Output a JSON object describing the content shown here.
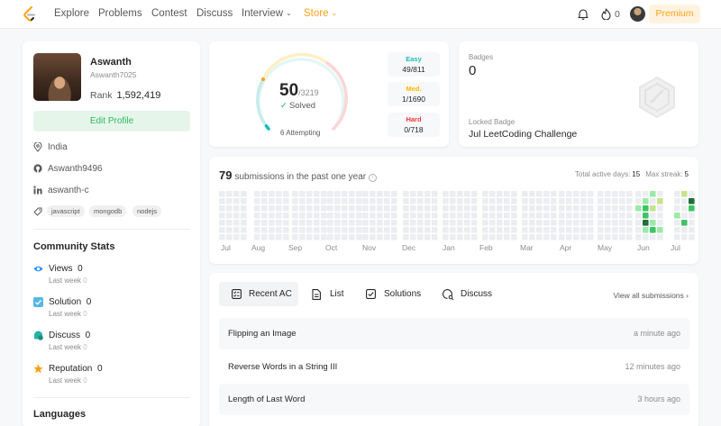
{
  "nav": {
    "items": [
      "Explore",
      "Problems",
      "Contest",
      "Discuss",
      "Interview",
      "Store"
    ],
    "fire_count": "0",
    "premium_label": "Premium"
  },
  "profile": {
    "name": "Aswanth",
    "username": "Aswanth7025",
    "rank_label": "Rank",
    "rank_value": "1,592,419",
    "edit_label": "Edit Profile",
    "location": "India",
    "github": "Aswanth9496",
    "linkedin": "aswanth-c",
    "skills": [
      "javascript",
      "mongodb",
      "nodejs"
    ]
  },
  "community": {
    "title": "Community Stats",
    "items": [
      {
        "label": "Views",
        "value": "0",
        "sub_label": "Last week",
        "sub_value": "0",
        "color": "#1890ff"
      },
      {
        "label": "Solution",
        "value": "0",
        "sub_label": "Last week",
        "sub_value": "0",
        "color": "#57b8e6"
      },
      {
        "label": "Discuss",
        "value": "0",
        "sub_label": "Last week",
        "sub_value": "0",
        "color": "#26b2a6"
      },
      {
        "label": "Reputation",
        "value": "0",
        "sub_label": "Last week",
        "sub_value": "0",
        "color": "#ffa116"
      }
    ]
  },
  "languages_title": "Languages",
  "solved": {
    "count": "50",
    "total": "/3219",
    "solved_label": "Solved",
    "attempting_count": "6",
    "attempting_label": "Attempting",
    "difficulties": [
      {
        "label": "Easy",
        "value": "49/811",
        "color": "#1cbaba"
      },
      {
        "label": "Med.",
        "value": "1/1690",
        "color": "#ffb700"
      },
      {
        "label": "Hard",
        "value": "0/718",
        "color": "#f63737"
      }
    ]
  },
  "badges": {
    "title": "Badges",
    "count": "0",
    "locked_title": "Locked Badge",
    "locked_name": "Jul LeetCoding Challenge"
  },
  "submissions": {
    "count": "79",
    "label": "submissions in the past one year",
    "active_days_label": "Total active days:",
    "active_days": "15",
    "max_streak_label": "Max streak:",
    "max_streak": "5",
    "months": [
      "Jul",
      "Aug",
      "Sep",
      "Oct",
      "Nov",
      "Dec",
      "Jan",
      "Feb",
      "Mar",
      "Apr",
      "May",
      "Jun",
      "Jul"
    ]
  },
  "recent": {
    "tabs": [
      "Recent AC",
      "List",
      "Solutions",
      "Discuss"
    ],
    "view_all": "View all submissions",
    "rows": [
      {
        "title": "Flipping an Image",
        "time": "a minute ago"
      },
      {
        "title": "Reverse Words in a String III",
        "time": "12 minutes ago"
      },
      {
        "title": "Length of Last Word",
        "time": "3 hours ago"
      }
    ]
  }
}
